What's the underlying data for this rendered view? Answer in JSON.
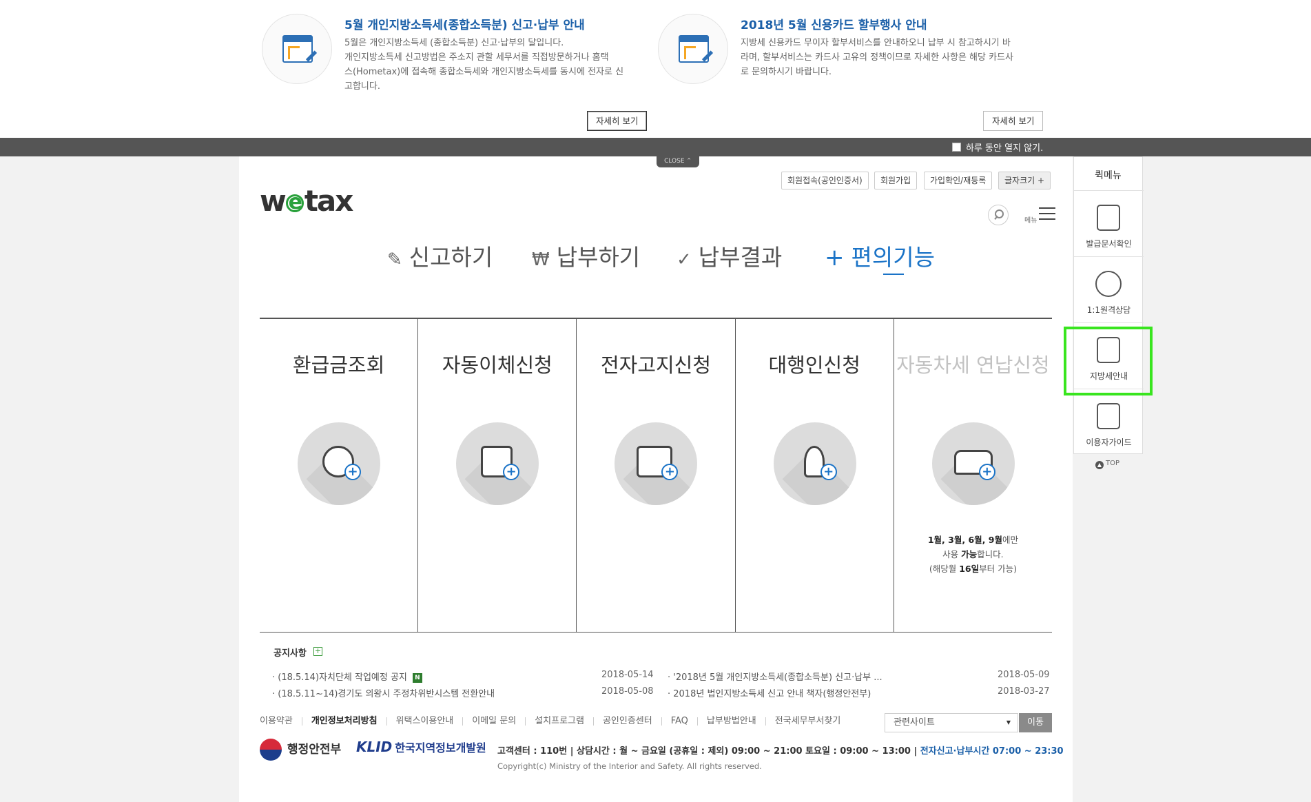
{
  "popup": {
    "notices": [
      {
        "title": "5월 개인지방소득세(종합소득분) 신고·납부 안내",
        "lines": [
          "5월은 개인지방소득세 (종합소득분) 신고·납부의 달입니다.",
          "개인지방소득세 신고방법은 주소지 관할 세무서를 직접방문하거나 홈택",
          "스(Hometax)에 접속해 종합소득세와 개인지방소득세를 동시에 전자로 신",
          "고합니다."
        ],
        "button": "자세히 보기"
      },
      {
        "title": "2018년 5월 신용카드 할부행사 안내",
        "lines": [
          "지방세 신용카드 무이자 할부서비스를 안내하오니 납부 시 참고하시기 바",
          "라며, 할부서비스는 카드사 고유의 정책이므로 자세한 사항은 해당 카드사",
          "로 문의하시기 바랍니다."
        ],
        "button": "자세히 보기"
      }
    ],
    "dont_show_today": "하루 동안 열지 않기.",
    "close": "CLOSE ⌃"
  },
  "header": {
    "logo_left": "w",
    "logo_e": "e",
    "logo_right": "tax",
    "util": [
      "회원접속(공인인증서)",
      "회원가입",
      "가입확인/재등록",
      "글자크기 +"
    ],
    "menu_label": "메뉴"
  },
  "gnb": [
    {
      "icon": "✎",
      "label": "신고하기"
    },
    {
      "icon": "₩",
      "label": "납부하기"
    },
    {
      "icon": "✓",
      "label": "납부결과"
    },
    {
      "icon": "+",
      "label": "편의기능"
    }
  ],
  "cards": [
    {
      "title": "환급금조회",
      "icon": "calculator-refund-icon"
    },
    {
      "title": "자동이체신청",
      "icon": "auto-transfer-icon"
    },
    {
      "title": "전자고지신청",
      "icon": "e-notice-icon"
    },
    {
      "title": "대행인신청",
      "icon": "agent-icon"
    },
    {
      "title": "자동차세 연납신청",
      "icon": "car-tax-icon",
      "note": {
        "l1_bold": "1월, 3월, 6월, 9월",
        "l1_rest": "에만",
        "l2_pre": "사용 ",
        "l2_bold": "가능",
        "l2_post": "합니다.",
        "l3_pre": "(해당월 ",
        "l3_bold": "16일",
        "l3_post": "부터 가능)"
      }
    }
  ],
  "notice": {
    "title": "공지사항",
    "plus": "+",
    "items_left": [
      {
        "text": "· (18.5.14)자치단체 작업예정 공지",
        "badge": "N",
        "date": "2018-05-14"
      },
      {
        "text": "· (18.5.11~14)경기도 의왕시 주정차위반시스템 전환안내",
        "date": "2018-05-08"
      }
    ],
    "items_right": [
      {
        "text": "· '2018년 5월 개인지방소득세(종합소득분) 신고·납부 ...",
        "date": "2018-05-09"
      },
      {
        "text": "· 2018년 법인지방소득세 신고 안내 책자(행정안전부)",
        "date": "2018-03-27"
      }
    ]
  },
  "footer": {
    "links": [
      "이용약관",
      "개인정보처리방침",
      "위택스이용안내",
      "이메일 문의",
      "설치프로그램",
      "공인인증센터",
      "FAQ",
      "납부방법안내",
      "전국세무부서찾기"
    ],
    "related_placeholder": "관련사이트",
    "go": "이동",
    "org1": "행정안전부",
    "org2_mark": "KLID",
    "org2": "한국지역정보개발원",
    "contact": "고객센터 : 110번  |  상담시간 : 월 ~ 금요일 (공휴일 : 제외) 09:00 ~ 21:00 토요일 : 09:00 ~ 13:00  |",
    "contact_blue": "전자신고·납부시간 07:00 ~ 23:30",
    "copyright": "Copyright(c) Ministry of the Interior and Safety. All rights reserved."
  },
  "quick": {
    "title": "퀵메뉴",
    "items": [
      {
        "label": "발급문서확인",
        "icon": "printer-icon"
      },
      {
        "label": "1:1원격상담",
        "icon": "headset-icon"
      },
      {
        "label": "지방세안내",
        "icon": "document-search-icon"
      },
      {
        "label": "이용자가이드",
        "icon": "guide-book-icon"
      }
    ],
    "top": "TOP"
  },
  "colors": {
    "accent_blue": "#1a73c7",
    "highlight_green": "#39e51f",
    "popup_bar": "#555555"
  }
}
